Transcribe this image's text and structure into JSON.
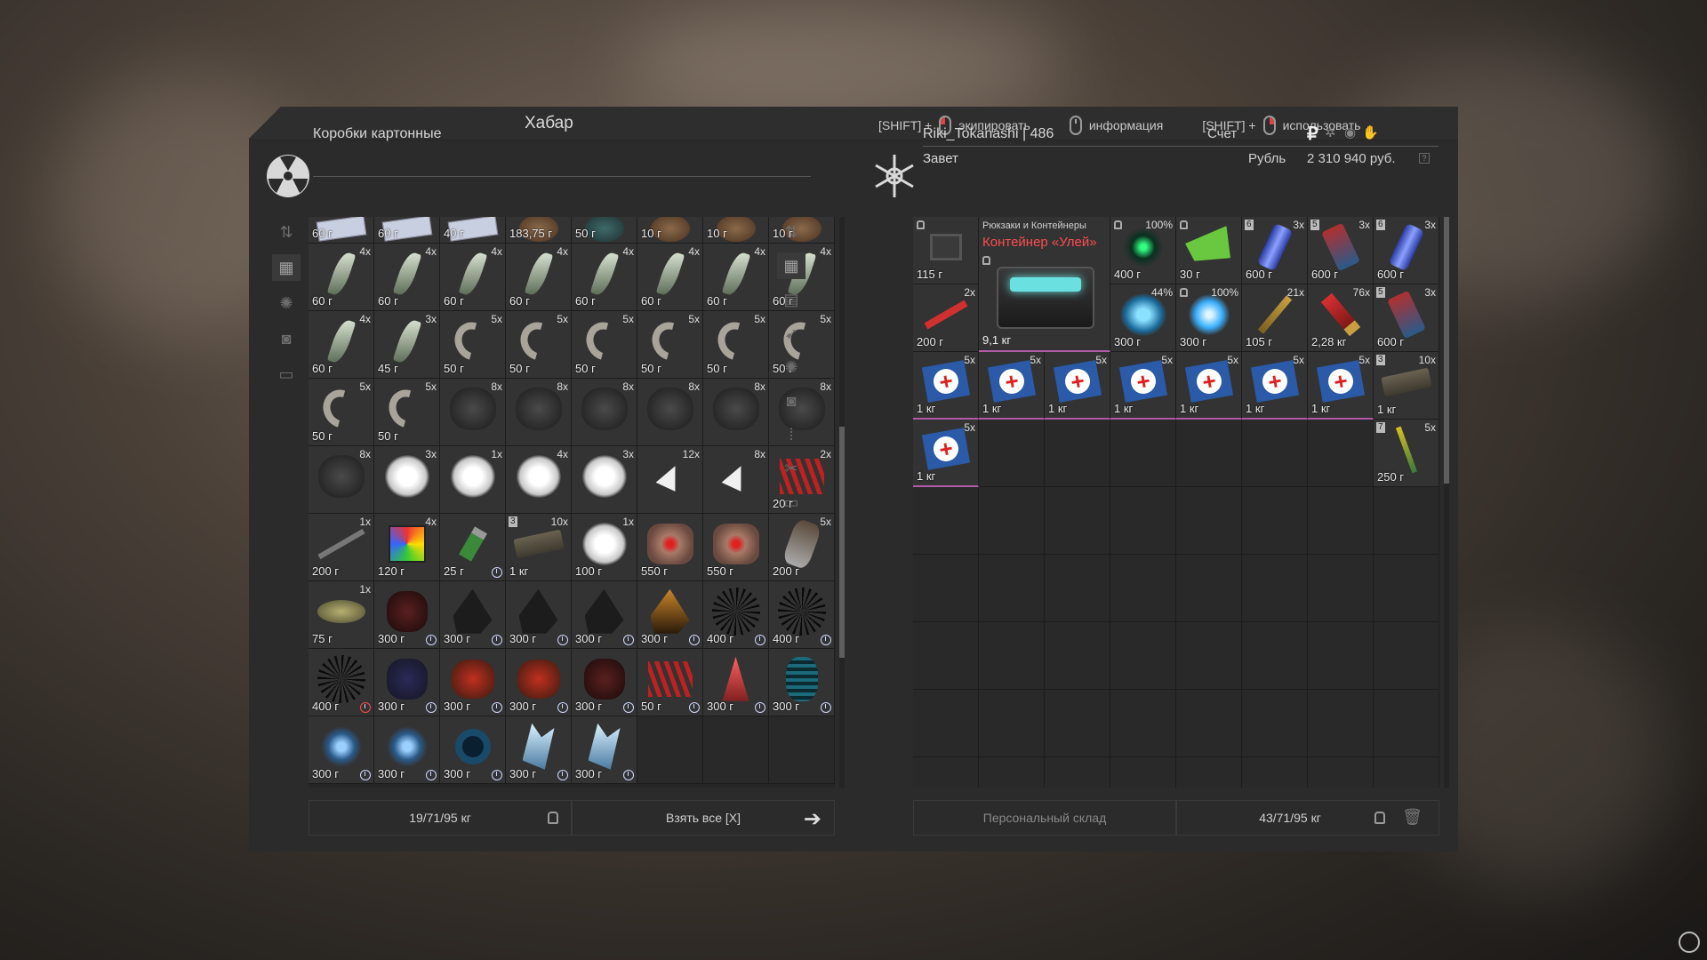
{
  "window_title": "Хабар",
  "hints": [
    {
      "prefix": "[SHIFT] +",
      "mouse": "left",
      "label": "экипировать"
    },
    {
      "prefix": "",
      "mouse": "middle",
      "label": "информация"
    },
    {
      "prefix": "[SHIFT] +",
      "mouse": "right",
      "label": "использовать"
    }
  ],
  "left_panel": {
    "container_name": "Коробки картонные",
    "icon": "radiation-icon",
    "weight": "19/71/95 кг",
    "take_all": "Взять все [X]",
    "items": [
      {
        "wt": "60 г",
        "qty": "",
        "art": "box"
      },
      {
        "wt": "60 г",
        "qty": "",
        "art": "box"
      },
      {
        "wt": "40 г",
        "qty": "",
        "art": "box"
      },
      {
        "wt": "183,75 г",
        "qty": "",
        "art": "brown"
      },
      {
        "wt": "50 г",
        "qty": "",
        "art": "teal"
      },
      {
        "wt": "10 г",
        "qty": "",
        "art": "brown"
      },
      {
        "wt": "10 г",
        "qty": "",
        "art": "brown"
      },
      {
        "wt": "10 г",
        "qty": "",
        "art": "brown"
      },
      {
        "wt": "60 г",
        "qty": "4x",
        "art": "fang"
      },
      {
        "wt": "60 г",
        "qty": "4x",
        "art": "fang"
      },
      {
        "wt": "60 г",
        "qty": "4x",
        "art": "fang"
      },
      {
        "wt": "60 г",
        "qty": "4x",
        "art": "fang"
      },
      {
        "wt": "60 г",
        "qty": "4x",
        "art": "fang"
      },
      {
        "wt": "60 г",
        "qty": "4x",
        "art": "fang"
      },
      {
        "wt": "60 г",
        "qty": "4x",
        "art": "fang"
      },
      {
        "wt": "60 г",
        "qty": "4x",
        "art": "fang"
      },
      {
        "wt": "60 г",
        "qty": "4x",
        "art": "fang"
      },
      {
        "wt": "45 г",
        "qty": "3x",
        "art": "fang"
      },
      {
        "wt": "50 г",
        "qty": "5x",
        "art": "claw"
      },
      {
        "wt": "50 г",
        "qty": "5x",
        "art": "claw"
      },
      {
        "wt": "50 г",
        "qty": "5x",
        "art": "claw"
      },
      {
        "wt": "50 г",
        "qty": "5x",
        "art": "claw"
      },
      {
        "wt": "50 г",
        "qty": "5x",
        "art": "claw"
      },
      {
        "wt": "50 г",
        "qty": "5x",
        "art": "claw"
      },
      {
        "wt": "50 г",
        "qty": "5x",
        "art": "claw"
      },
      {
        "wt": "50 г",
        "qty": "5x",
        "art": "claw"
      },
      {
        "wt": "",
        "qty": "8x",
        "art": "fur"
      },
      {
        "wt": "",
        "qty": "8x",
        "art": "fur"
      },
      {
        "wt": "",
        "qty": "8x",
        "art": "fur"
      },
      {
        "wt": "",
        "qty": "8x",
        "art": "fur"
      },
      {
        "wt": "",
        "qty": "8x",
        "art": "fur"
      },
      {
        "wt": "",
        "qty": "8x",
        "art": "fur"
      },
      {
        "wt": "",
        "qty": "8x",
        "art": "fur"
      },
      {
        "wt": "",
        "qty": "3x",
        "art": "cloud"
      },
      {
        "wt": "",
        "qty": "1x",
        "art": "cloud"
      },
      {
        "wt": "",
        "qty": "4x",
        "art": "cloud"
      },
      {
        "wt": "",
        "qty": "3x",
        "art": "cloud"
      },
      {
        "wt": "",
        "qty": "12x",
        "art": "shard"
      },
      {
        "wt": "",
        "qty": "8x",
        "art": "shard"
      },
      {
        "wt": "20 г",
        "qty": "2x",
        "art": "redspike"
      },
      {
        "wt": "200 г",
        "qty": "1x",
        "art": "knife"
      },
      {
        "wt": "120 г",
        "qty": "4x",
        "art": "cube"
      },
      {
        "wt": "25 г",
        "qty": "",
        "art": "usb",
        "timer": true
      },
      {
        "wt": "1 кг",
        "qty": "10x",
        "art": "bar",
        "lvl": "3"
      },
      {
        "wt": "100 г",
        "qty": "1x",
        "art": "cloud"
      },
      {
        "wt": "550 г",
        "qty": "",
        "art": "eye"
      },
      {
        "wt": "550 г",
        "qty": "",
        "art": "eye"
      },
      {
        "wt": "200 г",
        "qty": "5x",
        "art": "horn"
      },
      {
        "wt": "75 г",
        "qty": "1x",
        "art": "bird"
      },
      {
        "wt": "300 г",
        "qty": "",
        "art": "rock",
        "timer": true
      },
      {
        "wt": "300 г",
        "qty": "",
        "art": "rockdark",
        "timer": true
      },
      {
        "wt": "300 г",
        "qty": "",
        "art": "rockdark",
        "timer": true
      },
      {
        "wt": "300 г",
        "qty": "",
        "art": "rockdark",
        "timer": true
      },
      {
        "wt": "300 г",
        "qty": "",
        "art": "rockorange",
        "timer": true
      },
      {
        "wt": "400 г",
        "qty": "",
        "art": "star",
        "timer": true
      },
      {
        "wt": "400 г",
        "qty": "",
        "art": "star",
        "timer": true
      },
      {
        "wt": "400 г",
        "qty": "",
        "art": "star",
        "timer": true,
        "red": true
      },
      {
        "wt": "300 г",
        "qty": "",
        "art": "rockblue",
        "timer": true
      },
      {
        "wt": "300 г",
        "qty": "",
        "art": "rockred",
        "timer": true
      },
      {
        "wt": "300 г",
        "qty": "",
        "art": "rockred",
        "timer": true
      },
      {
        "wt": "300 г",
        "qty": "",
        "art": "rock",
        "timer": true
      },
      {
        "wt": "50 г",
        "qty": "",
        "art": "redspike",
        "timer": true
      },
      {
        "wt": "300 г",
        "qty": "",
        "art": "redcrystal",
        "timer": true
      },
      {
        "wt": "300 г",
        "qty": "",
        "art": "coil",
        "timer": true
      },
      {
        "wt": "300 г",
        "qty": "",
        "art": "bluestar",
        "timer": true
      },
      {
        "wt": "300 г",
        "qty": "",
        "art": "bluestar",
        "timer": true
      },
      {
        "wt": "300 г",
        "qty": "",
        "art": "bluering",
        "timer": true
      },
      {
        "wt": "300 г",
        "qty": "",
        "art": "icespike",
        "timer": true
      },
      {
        "wt": "300 г",
        "qty": "",
        "art": "icespike",
        "timer": true
      },
      {
        "wt": "",
        "qty": "",
        "art": ""
      },
      {
        "wt": "",
        "qty": "",
        "art": ""
      },
      {
        "wt": "",
        "qty": "",
        "art": ""
      }
    ]
  },
  "right_panel": {
    "player": "Riki_Tokanashi | 486",
    "faction": "Завет",
    "account_label": "Счет",
    "currency_label": "Рубль",
    "balance": "2 310 940 руб.",
    "storage_label": "Персональный склад",
    "weight": "43/71/95 кг",
    "container_card": {
      "category": "Рюкзаки и Контейнеры",
      "name": "Контейнер «Улей»",
      "weight": "9,1 кг"
    },
    "row1": [
      {
        "wt": "115 г",
        "qty": "",
        "art": "chair",
        "lock": true
      },
      {
        "skip": true
      },
      {
        "skip": true
      },
      {
        "wt": "400 г",
        "pct": "100%",
        "art": "greenstar",
        "lock": true
      },
      {
        "wt": "30 г",
        "qty": "",
        "art": "map",
        "lock": true
      },
      {
        "wt": "600 г",
        "qty": "3x",
        "art": "can",
        "lvl": "6"
      },
      {
        "wt": "600 г",
        "qty": "3x",
        "art": "pack",
        "lvl": "5"
      },
      {
        "wt": "600 г",
        "qty": "3x",
        "art": "can",
        "lvl": "6"
      }
    ],
    "row2": [
      {
        "wt": "200 г",
        "qty": "2x",
        "art": "flare"
      },
      {
        "skip": true
      },
      {
        "skip": true
      },
      {
        "wt": "300 г",
        "pct": "44%",
        "art": "bluedisc"
      },
      {
        "wt": "300 г",
        "pct": "100%",
        "art": "blueorb",
        "lock": true
      },
      {
        "wt": "105 г",
        "qty": "21x",
        "art": "bullet"
      },
      {
        "wt": "2,28 кг",
        "qty": "76x",
        "art": "shell"
      },
      {
        "wt": "600 г",
        "qty": "3x",
        "art": "pack",
        "lvl": "5"
      }
    ],
    "row3": [
      {
        "wt": "1 кг",
        "qty": "5x",
        "art": "medkit"
      },
      {
        "wt": "1 кг",
        "qty": "5x",
        "art": "medkit"
      },
      {
        "wt": "1 кг",
        "qty": "5x",
        "art": "medkit"
      },
      {
        "wt": "1 кг",
        "qty": "5x",
        "art": "medkit"
      },
      {
        "wt": "1 кг",
        "qty": "5x",
        "art": "medkit"
      },
      {
        "wt": "1 кг",
        "qty": "5x",
        "art": "medkit"
      },
      {
        "wt": "1 кг",
        "qty": "5x",
        "art": "medkit"
      },
      {
        "wt": "1 кг",
        "qty": "10x",
        "art": "bar",
        "lvl": "3"
      }
    ],
    "row4": [
      {
        "wt": "1 кг",
        "qty": "5x",
        "art": "medkit"
      },
      {
        "wt": "",
        "qty": "",
        "art": ""
      },
      {
        "wt": "",
        "qty": "",
        "art": ""
      },
      {
        "wt": "",
        "qty": "",
        "art": ""
      },
      {
        "wt": "",
        "qty": "",
        "art": ""
      },
      {
        "wt": "",
        "qty": "",
        "art": ""
      },
      {
        "wt": "",
        "qty": "",
        "art": ""
      },
      {
        "wt": "250 г",
        "qty": "5x",
        "art": "syringe",
        "lvl": "7"
      }
    ]
  },
  "colors": {
    "accent_red": "#ff4d4d",
    "pink_border": "#b05aa8",
    "timer": "#cfd8ff",
    "timer_red": "#ff4a4a"
  }
}
